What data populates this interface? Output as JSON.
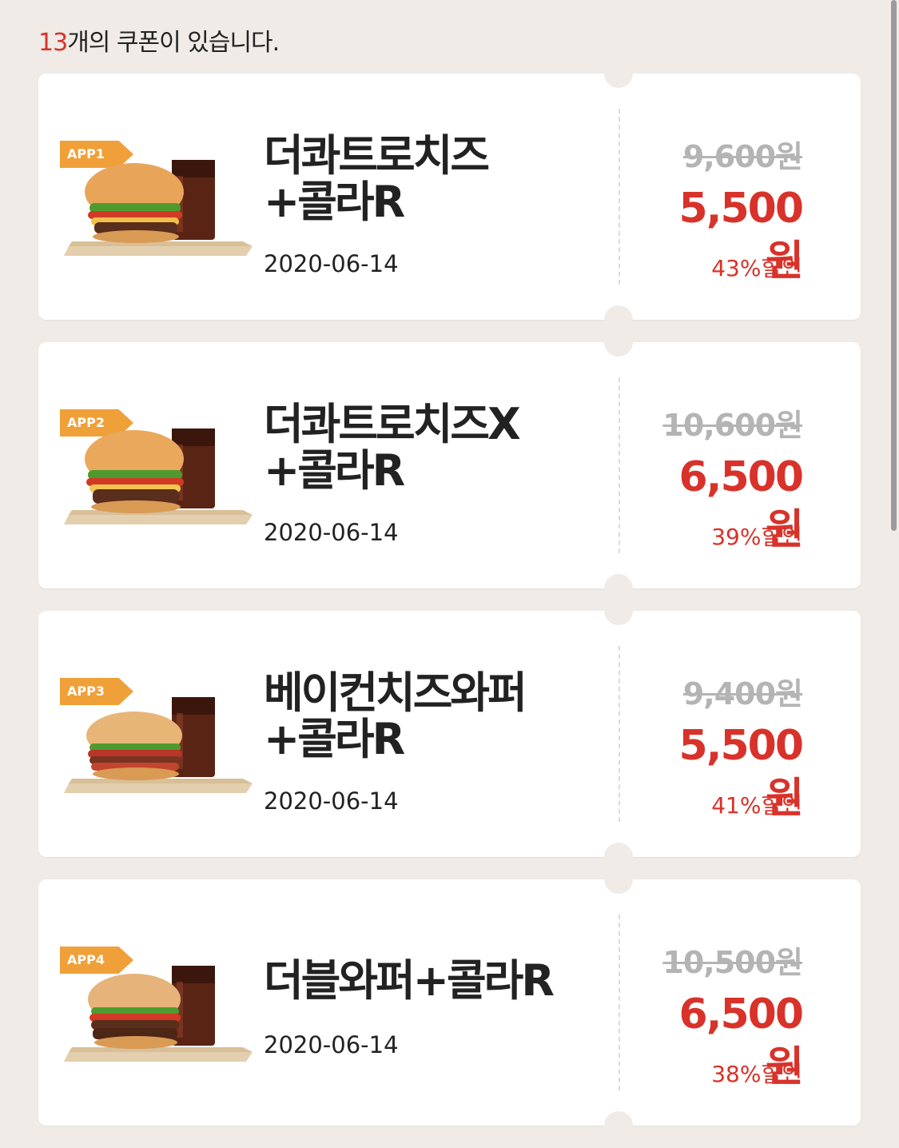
{
  "summary": {
    "count": "13",
    "suffix": "개의 쿠폰이 있습니다."
  },
  "colors": {
    "accent": "#d8322a",
    "tag": "#f0a038",
    "background": "#f0ebe6"
  },
  "coupons": [
    {
      "tag": "APP1",
      "title": "더콰트로치즈\n+콜라R",
      "date": "2020-06-14",
      "original_price": "9,600원",
      "sale_price": "5,500원",
      "discount": "43%할인",
      "image_icon": "burger-combo-image"
    },
    {
      "tag": "APP2",
      "title": "더콰트로치즈X\n+콜라R",
      "date": "2020-06-14",
      "original_price": "10,600원",
      "sale_price": "6,500원",
      "discount": "39%할인",
      "image_icon": "burger-combo-image"
    },
    {
      "tag": "APP3",
      "title": "베이컨치즈와퍼\n+콜라R",
      "date": "2020-06-14",
      "original_price": "9,400원",
      "sale_price": "5,500원",
      "discount": "41%할인",
      "image_icon": "burger-combo-image"
    },
    {
      "tag": "APP4",
      "title": "더블와퍼+콜라R",
      "date": "2020-06-14",
      "original_price": "10,500원",
      "sale_price": "6,500원",
      "discount": "38%할인",
      "image_icon": "burger-combo-image"
    }
  ]
}
